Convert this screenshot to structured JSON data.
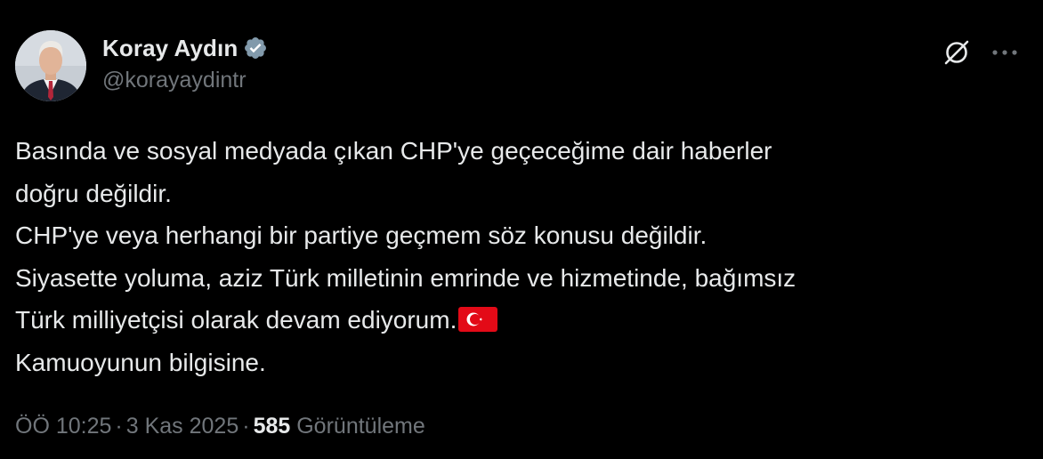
{
  "author": {
    "name": "Koray Aydın",
    "handle": "@korayaydintr",
    "verified_color": "#829aab",
    "avatar_icon": "profile-photo"
  },
  "actions": {
    "grok_icon": "grok-icon",
    "more_icon": "more-horizontal-icon"
  },
  "tweet": {
    "lines": [
      "Basında ve sosyal medyada çıkan CHP'ye geçeceğime dair haberler",
      "doğru değildir.",
      "CHP'ye veya herhangi bir partiye geçmem söz konusu değildir.",
      "Siyasette yoluma, aziz Türk milletinin emrinde ve hizmetinde, bağımsız",
      "Türk milliyetçisi olarak devam ediyorum.",
      "Kamuoyunun bilgisine."
    ],
    "flag_icon": "turkey-flag-icon"
  },
  "meta": {
    "time": "ÖÖ 10:25",
    "separator": "·",
    "date": "3 Kas 2025",
    "views_count": "585",
    "views_label": "Görüntüleme"
  },
  "colors": {
    "background": "#000000",
    "text": "#e7e9ea",
    "secondary_text": "#71767b",
    "flag_red": "#e30a17"
  }
}
